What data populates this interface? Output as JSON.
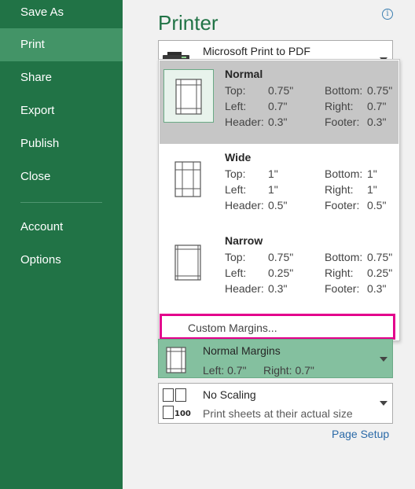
{
  "sidebar": {
    "items": [
      {
        "label": "Save As"
      },
      {
        "label": "Print"
      },
      {
        "label": "Share"
      },
      {
        "label": "Export"
      },
      {
        "label": "Publish"
      },
      {
        "label": "Close"
      },
      {
        "label": "Account"
      },
      {
        "label": "Options"
      }
    ],
    "active_index": 1,
    "colors": {
      "background": "#217346",
      "active": "#439467"
    }
  },
  "printer": {
    "title": "Printer",
    "selected": "Microsoft Print to PDF"
  },
  "margins_dropdown": {
    "options": [
      {
        "name": "Normal",
        "top_label": "Top:",
        "top": "0.75\"",
        "bottom_label": "Bottom:",
        "bottom": "0.75\"",
        "left_label": "Left:",
        "left": "0.7\"",
        "right_label": "Right:",
        "right": "0.7\"",
        "header_label": "Header:",
        "header": "0.3\"",
        "footer_label": "Footer:",
        "footer": "0.3\"",
        "selected": true
      },
      {
        "name": "Wide",
        "top_label": "Top:",
        "top": "1\"",
        "bottom_label": "Bottom:",
        "bottom": "1\"",
        "left_label": "Left:",
        "left": "1\"",
        "right_label": "Right:",
        "right": "1\"",
        "header_label": "Header:",
        "header": "0.5\"",
        "footer_label": "Footer:",
        "footer": "0.5\"",
        "selected": false
      },
      {
        "name": "Narrow",
        "top_label": "Top:",
        "top": "0.75\"",
        "bottom_label": "Bottom:",
        "bottom": "0.75\"",
        "left_label": "Left:",
        "left": "0.25\"",
        "right_label": "Right:",
        "right": "0.25\"",
        "header_label": "Header:",
        "header": "0.3\"",
        "footer_label": "Footer:",
        "footer": "0.3\"",
        "selected": false
      }
    ],
    "custom_label": "Custom Margins...",
    "highlight_color": "#e3008c"
  },
  "margins_setting": {
    "title": "Normal Margins",
    "left": "Left:  0.7\"",
    "right": "Right:  0.7\""
  },
  "scaling_setting": {
    "title": "No Scaling",
    "subtitle": "Print sheets at their actual size",
    "icon_text": "100"
  },
  "page_setup_link": "Page Setup"
}
